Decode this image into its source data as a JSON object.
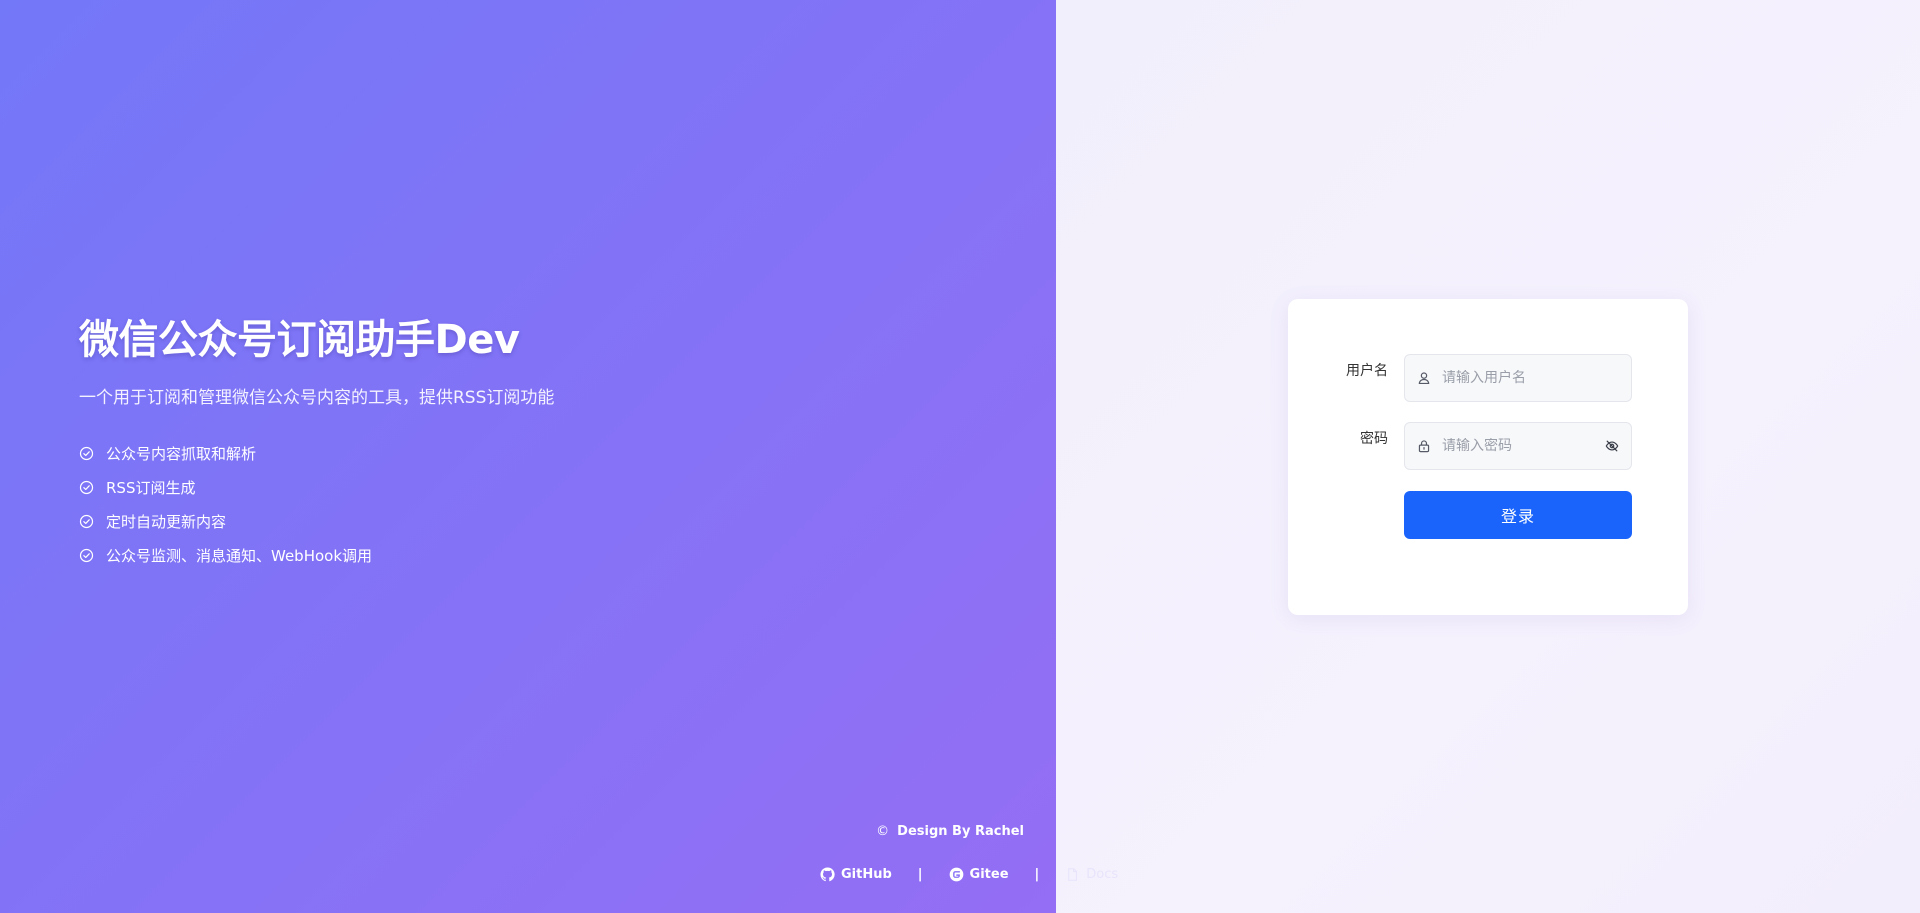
{
  "app": {
    "title": "微信公众号订阅助手Dev",
    "subtitle": "一个用于订阅和管理微信公众号内容的工具，提供RSS订阅功能",
    "features": [
      "公众号内容抓取和解析",
      "RSS订阅生成",
      "定时自动更新内容",
      "公众号监测、消息通知、WebHook调用"
    ]
  },
  "footer": {
    "copyright_symbol": "©",
    "credit": "Design By Rachel",
    "links": {
      "github": "GitHub",
      "gitee": "Gitee",
      "docs": "Docs"
    },
    "separator": "|"
  },
  "login": {
    "username_label": "用户名",
    "username_placeholder": "请输入用户名",
    "username_value": "",
    "password_label": "密码",
    "password_placeholder": "请输入密码",
    "password_value": "",
    "submit_label": "登录"
  },
  "colors": {
    "gradient_start": "#7378f8",
    "gradient_end": "#946ef4",
    "primary_button": "#1a64fb",
    "right_background": "#f3f0fc"
  },
  "icons": {
    "feature": "check-circle-icon",
    "username": "user-icon",
    "password": "lock-icon",
    "password_toggle": "eye-off-icon",
    "github": "github-icon",
    "gitee": "gitee-icon",
    "docs": "document-icon"
  }
}
